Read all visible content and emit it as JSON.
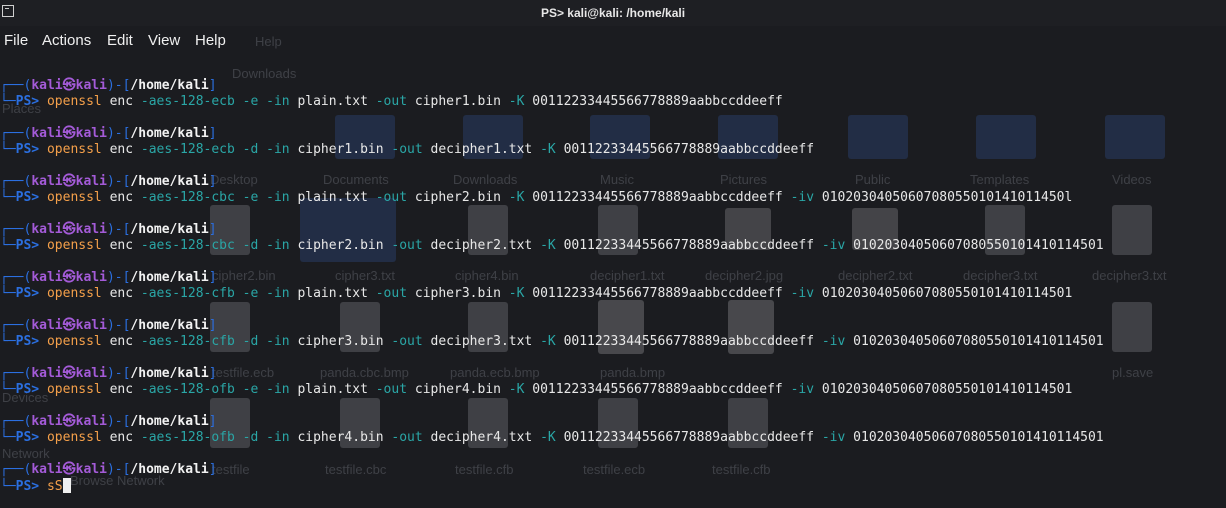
{
  "window": {
    "title": "PS> kali@kali: /home/kali"
  },
  "menu": [
    "File",
    "Actions",
    "Edit",
    "View",
    "Help"
  ],
  "prompt": {
    "user": "kali",
    "host": "kali",
    "path": "/home/kali",
    "ps": "PS>"
  },
  "commands": [
    {
      "cmd": "openssl",
      "sub": "enc",
      "parts": [
        {
          "t": "-aes-128-ecb",
          "k": "flag"
        },
        {
          "t": "-e",
          "k": "flag"
        },
        {
          "t": "-in",
          "k": "flag"
        },
        {
          "t": "plain.txt",
          "k": "arg"
        },
        {
          "t": "-out",
          "k": "flag"
        },
        {
          "t": "cipher1.bin",
          "k": "arg"
        },
        {
          "t": "-K",
          "k": "flag"
        },
        {
          "t": "00112233445566778889aabbccddeeff",
          "k": "arg"
        }
      ]
    },
    {
      "cmd": "openssl",
      "sub": "enc",
      "parts": [
        {
          "t": "-aes-128-ecb",
          "k": "flag"
        },
        {
          "t": "-d",
          "k": "flag"
        },
        {
          "t": "-in",
          "k": "flag"
        },
        {
          "t": "cipher1.bin",
          "k": "arg"
        },
        {
          "t": "-out",
          "k": "flag"
        },
        {
          "t": "decipher1.txt",
          "k": "arg"
        },
        {
          "t": "-K",
          "k": "flag"
        },
        {
          "t": "00112233445566778889aabbccddeeff",
          "k": "arg"
        }
      ]
    },
    {
      "cmd": "openssl",
      "sub": "enc",
      "parts": [
        {
          "t": "-aes-128-cbc",
          "k": "flag"
        },
        {
          "t": "-e",
          "k": "flag"
        },
        {
          "t": "-in",
          "k": "flag"
        },
        {
          "t": "plain.txt",
          "k": "arg"
        },
        {
          "t": "-out",
          "k": "flag"
        },
        {
          "t": "cipher2.bin",
          "k": "arg"
        },
        {
          "t": "-K",
          "k": "flag"
        },
        {
          "t": "00112233445566778889aabbccddeeff",
          "k": "arg"
        },
        {
          "t": "-iv",
          "k": "flag"
        },
        {
          "t": "0102030405060708055010141011450l",
          "k": "arg"
        }
      ]
    },
    {
      "cmd": "openssl",
      "sub": "enc",
      "parts": [
        {
          "t": "-aes-128-cbc",
          "k": "flag"
        },
        {
          "t": "-d",
          "k": "flag"
        },
        {
          "t": "-in",
          "k": "flag"
        },
        {
          "t": "cipher2.bin",
          "k": "arg"
        },
        {
          "t": "-out",
          "k": "flag"
        },
        {
          "t": "decipher2.txt",
          "k": "arg"
        },
        {
          "t": "-K",
          "k": "flag"
        },
        {
          "t": "00112233445566778889aabbccddeeff",
          "k": "arg"
        },
        {
          "t": "-iv",
          "k": "flag"
        },
        {
          "t": "01020304050607080550101410114501",
          "k": "arg"
        }
      ]
    },
    {
      "cmd": "openssl",
      "sub": "enc",
      "parts": [
        {
          "t": "-aes-128-cfb",
          "k": "flag"
        },
        {
          "t": "-e",
          "k": "flag"
        },
        {
          "t": "-in",
          "k": "flag"
        },
        {
          "t": "plain.txt",
          "k": "arg"
        },
        {
          "t": "-out",
          "k": "flag"
        },
        {
          "t": "cipher3.bin",
          "k": "arg"
        },
        {
          "t": "-K",
          "k": "flag"
        },
        {
          "t": "00112233445566778889aabbccddeeff",
          "k": "arg"
        },
        {
          "t": "-iv",
          "k": "flag"
        },
        {
          "t": "01020304050607080550101410114501",
          "k": "arg"
        }
      ]
    },
    {
      "cmd": "openssl",
      "sub": "enc",
      "parts": [
        {
          "t": "-aes-128-cfb",
          "k": "flag"
        },
        {
          "t": "-d",
          "k": "flag"
        },
        {
          "t": "-in",
          "k": "flag"
        },
        {
          "t": "cipher3.bin",
          "k": "arg"
        },
        {
          "t": "-out",
          "k": "flag"
        },
        {
          "t": "decipher3.txt",
          "k": "arg"
        },
        {
          "t": "-K",
          "k": "flag"
        },
        {
          "t": "00112233445566778889aabbccddeeff",
          "k": "arg"
        },
        {
          "t": "-iv",
          "k": "flag"
        },
        {
          "t": "01020304050607080550101410114501",
          "k": "arg"
        }
      ]
    },
    {
      "cmd": "openssl",
      "sub": "enc",
      "parts": [
        {
          "t": "-aes-128-ofb",
          "k": "flag"
        },
        {
          "t": "-e",
          "k": "flag"
        },
        {
          "t": "-in",
          "k": "flag"
        },
        {
          "t": "plain.txt",
          "k": "arg"
        },
        {
          "t": "-out",
          "k": "flag"
        },
        {
          "t": "cipher4.bin",
          "k": "arg"
        },
        {
          "t": "-K",
          "k": "flag"
        },
        {
          "t": "00112233445566778889aabbccddeeff",
          "k": "arg"
        },
        {
          "t": "-iv",
          "k": "flag"
        },
        {
          "t": "01020304050607080550101410114501",
          "k": "arg"
        }
      ]
    },
    {
      "cmd": "openssl",
      "sub": "enc",
      "parts": [
        {
          "t": "-aes-128-ofb",
          "k": "flag"
        },
        {
          "t": "-d",
          "k": "flag"
        },
        {
          "t": "-in",
          "k": "flag"
        },
        {
          "t": "cipher4.bin",
          "k": "arg"
        },
        {
          "t": "-out",
          "k": "flag"
        },
        {
          "t": "decipher4.txt",
          "k": "arg"
        },
        {
          "t": "-K",
          "k": "flag"
        },
        {
          "t": "00112233445566778889aabbccddeeff",
          "k": "arg"
        },
        {
          "t": "-iv",
          "k": "flag"
        },
        {
          "t": "01020304050607080550101410114501",
          "k": "arg"
        }
      ]
    }
  ],
  "current_input": "sS",
  "background_labels": [
    "Help",
    "Downloads",
    "Places",
    "Desktop",
    "Documents",
    "Downloads",
    "Music",
    "Pictures",
    "Public",
    "Templates",
    "Videos",
    "cipher2.bin",
    "cipher3.txt",
    "cipher4.bin",
    "decipher1.txt",
    "decipher2.jpg",
    "decipher2.txt",
    "decipher3.txt",
    "decipher3.txt",
    "testfile.ecb",
    "panda.cbc.bmp",
    "panda.ecb.bmp",
    "panda.bmp",
    "pl.save",
    "Devices",
    "Network",
    "testfile",
    "testfile.cbc",
    "testfile.cfb",
    "testfile.ecb",
    "testfile.cfb",
    "Browse Network"
  ]
}
